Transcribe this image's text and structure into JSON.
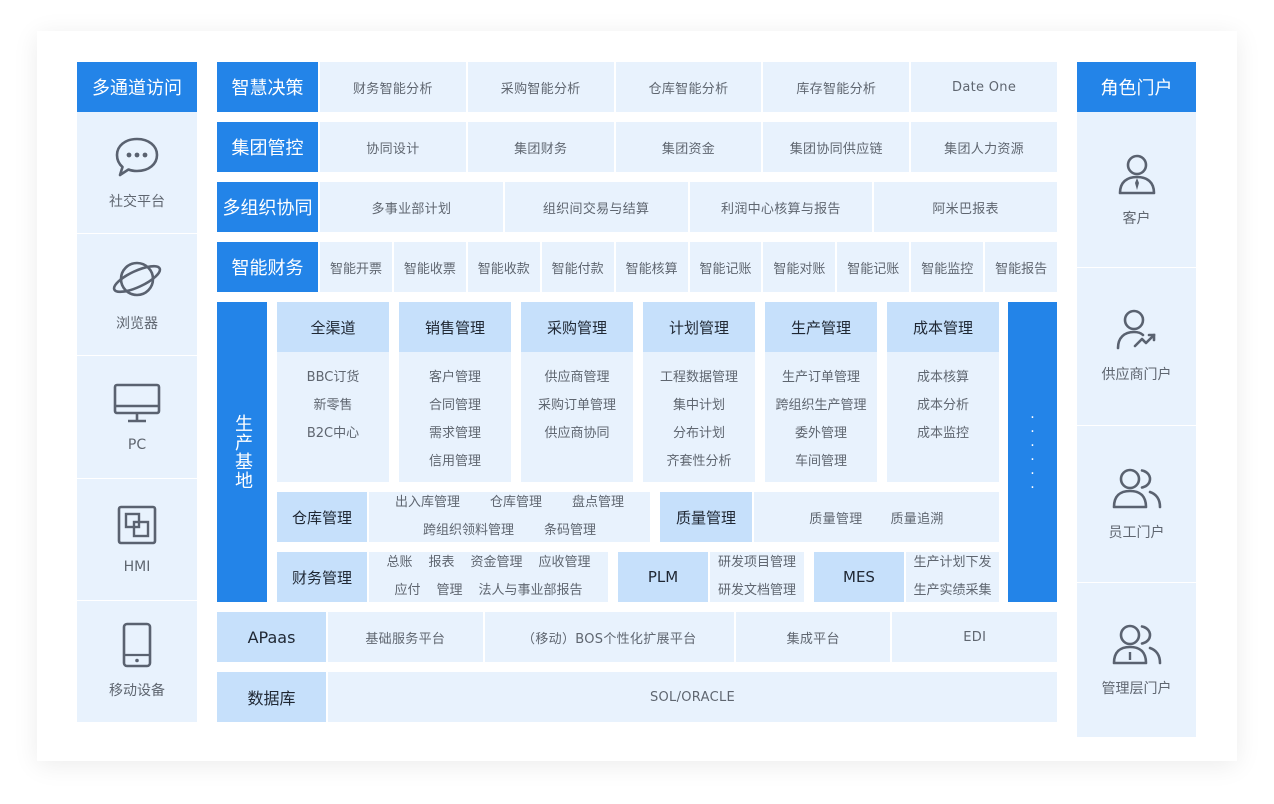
{
  "left": {
    "title": "多通道访问",
    "items": [
      {
        "label": "社交平台",
        "icon": "chat-bubble-icon"
      },
      {
        "label": "浏览器",
        "icon": "planet-icon"
      },
      {
        "label": "PC",
        "icon": "monitor-icon"
      },
      {
        "label": "HMI",
        "icon": "hmi-icon"
      },
      {
        "label": "移动设备",
        "icon": "mobile-icon"
      }
    ]
  },
  "right": {
    "title": "角色门户",
    "items": [
      {
        "label": "客户",
        "icon": "customer-icon"
      },
      {
        "label": "供应商门户",
        "icon": "supplier-icon"
      },
      {
        "label": "员工门户",
        "icon": "employees-icon"
      },
      {
        "label": "管理层门户",
        "icon": "management-icon"
      }
    ]
  },
  "rows": {
    "decision": {
      "title": "智慧决策",
      "items": [
        "财务智能分析",
        "采购智能分析",
        "仓库智能分析",
        "库存智能分析",
        "Date One"
      ]
    },
    "group": {
      "title": "集团管控",
      "items": [
        "协同设计",
        "集团财务",
        "集团资金",
        "集团协同供应链",
        "集团人力资源"
      ]
    },
    "multiorg": {
      "title": "多组织协同",
      "items": [
        "多事业部计划",
        "组织间交易与结算",
        "利润中心核算与报告",
        "阿米巴报表"
      ]
    },
    "finance": {
      "title": "智能财务",
      "items": [
        "智能开票",
        "智能收票",
        "智能收款",
        "智能付款",
        "智能核算",
        "智能记账",
        "智能对账",
        "智能记账",
        "智能监控",
        "智能报告"
      ]
    }
  },
  "production": {
    "title": "生产基地",
    "more": "······",
    "modules": [
      {
        "title": "全渠道",
        "items": [
          "BBC订货",
          "新零售",
          "B2C中心"
        ]
      },
      {
        "title": "销售管理",
        "items": [
          "客户管理",
          "合同管理",
          "需求管理",
          "信用管理"
        ]
      },
      {
        "title": "采购管理",
        "items": [
          "供应商管理",
          "采购订单管理",
          "供应商协同"
        ]
      },
      {
        "title": "计划管理",
        "items": [
          "工程数据管理",
          "集中计划",
          "分布计划",
          "齐套性分析"
        ]
      },
      {
        "title": "生产管理",
        "items": [
          "生产订单管理",
          "跨组织生产管理",
          "委外管理",
          "车间管理"
        ]
      },
      {
        "title": "成本管理",
        "items": [
          "成本核算",
          "成本分析",
          "成本监控"
        ]
      }
    ],
    "warehouse": {
      "title": "仓库管理",
      "line1": [
        "出入库管理",
        "仓库管理",
        "盘点管理"
      ],
      "line2": [
        "跨组织领料管理",
        "条码管理"
      ]
    },
    "quality": {
      "title": "质量管理",
      "items": [
        "质量管理",
        "质量追溯"
      ]
    },
    "fin": {
      "title": "财务管理",
      "line1": [
        "总账",
        "报表",
        "资金管理",
        "应收管理"
      ],
      "line2": [
        "应付",
        "管理",
        "法人与事业部报告"
      ]
    },
    "plm": {
      "title": "PLM",
      "items": [
        "研发项目管理",
        "研发文档管理"
      ]
    },
    "mes": {
      "title": "MES",
      "items": [
        "生产计划下发",
        "生产实绩采集"
      ]
    }
  },
  "apaas": {
    "title": "APaas",
    "items": [
      "基础服务平台",
      "（移动）BOS个性化扩展平台",
      "集成平台",
      "EDI"
    ]
  },
  "db": {
    "title": "数据库",
    "value": "SOL/ORACLE"
  },
  "colors": {
    "primary": "#2384e8",
    "light": "#c6e0fb",
    "cell": "#e8f2fd"
  }
}
